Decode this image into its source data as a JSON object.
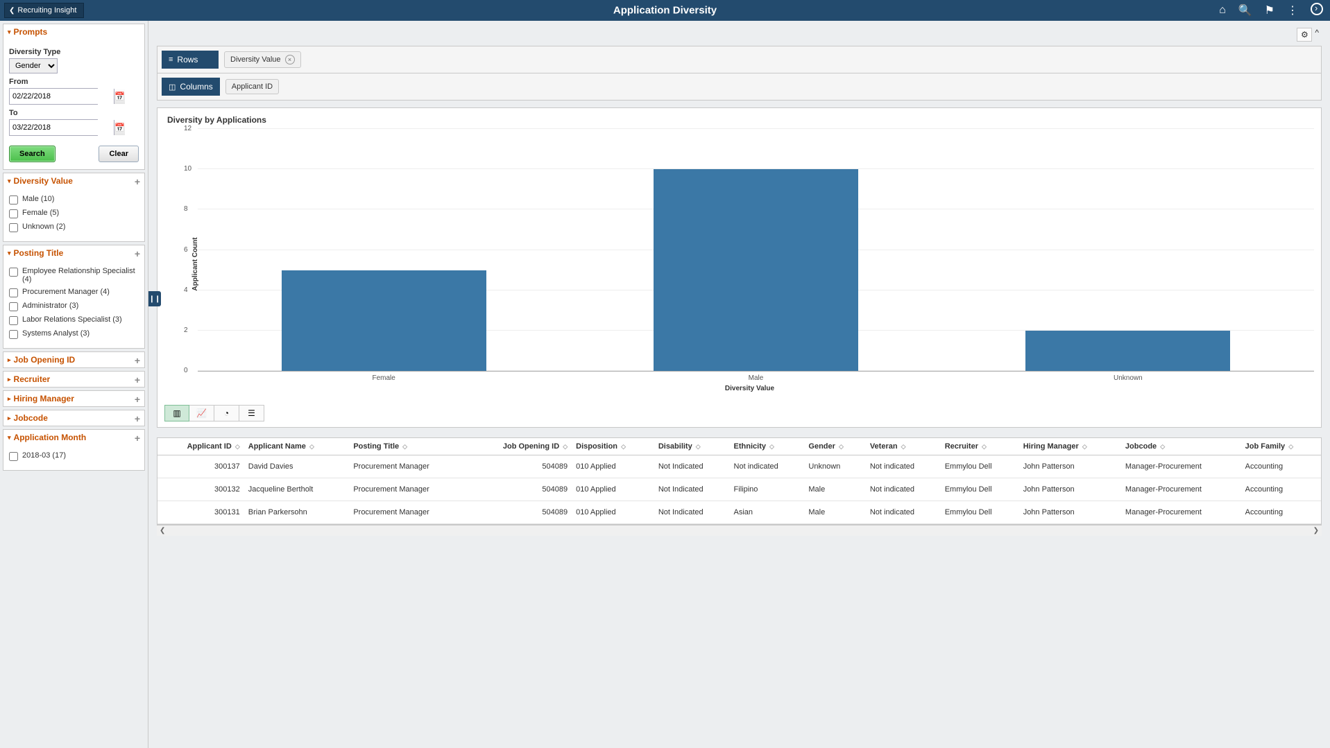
{
  "header": {
    "back_label": "Recruiting Insight",
    "title": "Application Diversity"
  },
  "sidebar": {
    "prompts": {
      "label": "Prompts",
      "diversity_type_label": "Diversity Type",
      "diversity_type_value": "Gender",
      "from_label": "From",
      "from_value": "02/22/2018",
      "to_label": "To",
      "to_value": "03/22/2018",
      "search_label": "Search",
      "clear_label": "Clear"
    },
    "diversity_value": {
      "label": "Diversity Value",
      "items": [
        "Male (10)",
        "Female (5)",
        "Unknown (2)"
      ]
    },
    "posting_title": {
      "label": "Posting Title",
      "items": [
        "Employee Relationship Specialist (4)",
        "Procurement Manager (4)",
        "Administrator (3)",
        "Labor Relations Specialist (3)",
        "Systems Analyst (3)"
      ]
    },
    "collapsed": [
      {
        "label": "Job Opening ID"
      },
      {
        "label": "Recruiter"
      },
      {
        "label": "Hiring Manager"
      },
      {
        "label": "Jobcode"
      }
    ],
    "app_month": {
      "label": "Application Month",
      "items": [
        "2018-03 (17)"
      ]
    }
  },
  "pivot": {
    "rows_label": "Rows",
    "columns_label": "Columns",
    "row_chips": [
      "Diversity Value"
    ],
    "col_chips": [
      "Applicant ID"
    ]
  },
  "chart_data": {
    "type": "bar",
    "title": "Diversity by Applications",
    "categories": [
      "Female",
      "Male",
      "Unknown"
    ],
    "values": [
      5,
      10,
      2
    ],
    "xlabel": "Diversity Value",
    "ylabel": "Applicant Count",
    "ylim": [
      0,
      12
    ],
    "yticks": [
      0,
      2,
      4,
      6,
      8,
      10,
      12
    ]
  },
  "table": {
    "columns": [
      "Applicant ID",
      "Applicant Name",
      "Posting Title",
      "Job Opening ID",
      "Disposition",
      "Disability",
      "Ethnicity",
      "Gender",
      "Veteran",
      "Recruiter",
      "Hiring Manager",
      "Jobcode",
      "Job Family"
    ],
    "rows": [
      {
        "applicant_id": "300137",
        "applicant_name": "David Davies",
        "posting_title": "Procurement Manager",
        "job_opening_id": "504089",
        "disposition": "010 Applied",
        "disability": "Not Indicated",
        "ethnicity": "Not indicated",
        "gender": "Unknown",
        "veteran": "Not indicated",
        "recruiter": "Emmylou Dell",
        "hiring_manager": "John Patterson",
        "jobcode": "Manager-Procurement",
        "job_family": "Accounting"
      },
      {
        "applicant_id": "300132",
        "applicant_name": "Jacqueline Bertholt",
        "posting_title": "Procurement Manager",
        "job_opening_id": "504089",
        "disposition": "010 Applied",
        "disability": "Not Indicated",
        "ethnicity": "Filipino",
        "gender": "Male",
        "veteran": "Not indicated",
        "recruiter": "Emmylou Dell",
        "hiring_manager": "John Patterson",
        "jobcode": "Manager-Procurement",
        "job_family": "Accounting"
      },
      {
        "applicant_id": "300131",
        "applicant_name": "Brian Parkersohn",
        "posting_title": "Procurement Manager",
        "job_opening_id": "504089",
        "disposition": "010 Applied",
        "disability": "Not Indicated",
        "ethnicity": "Asian",
        "gender": "Male",
        "veteran": "Not indicated",
        "recruiter": "Emmylou Dell",
        "hiring_manager": "John Patterson",
        "jobcode": "Manager-Procurement",
        "job_family": "Accounting"
      }
    ]
  }
}
